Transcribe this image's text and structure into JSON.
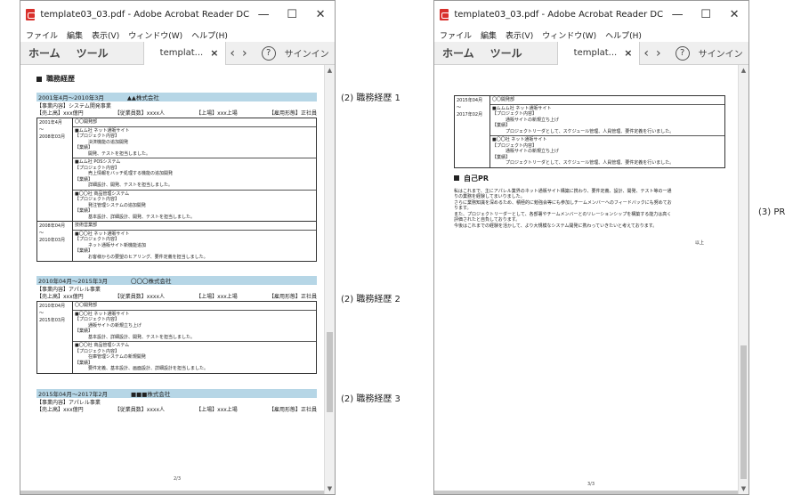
{
  "windows": [
    {
      "title": "template03_03.pdf - Adobe Acrobat Reader DC",
      "menu": [
        "ファイル",
        "編集",
        "表示(V)",
        "ウィンドウ(W)",
        "ヘルプ(H)"
      ],
      "toolbar": {
        "home": "ホーム",
        "tools": "ツール",
        "doc_tab": "templat...",
        "close": "×",
        "signin": "サインイン"
      }
    },
    {
      "title": "template03_03.pdf - Adobe Acrobat Reader DC",
      "menu": [
        "ファイル",
        "編集",
        "表示(V)",
        "ウィンドウ(W)",
        "ヘルプ(H)"
      ],
      "toolbar": {
        "home": "ホーム",
        "tools": "ツール",
        "doc_tab": "templat...",
        "close": "×",
        "signin": "サインイン"
      }
    }
  ],
  "page2": {
    "heading": "職務経歴",
    "careers": [
      {
        "period": "2001年4月～2010年3月",
        "company": "▲▲株式会社",
        "business": "【事業内容】システム開発事業",
        "capital": "【売上高】xxx億円",
        "employees": "【従業員数】xxxx人",
        "listing": "【上場】xxx上場",
        "employment": "【雇用形態】正社員",
        "rows": [
          {
            "from": "2001年4月",
            "tilde": "～",
            "to": "2008年03月",
            "blocks": [
              [
                "〇〇開発部"
              ],
              [
                "■ムム社 ネット通販サイト",
                "【プロジェクト内容】",
                "　決済機能の追加開発",
                "【業績】",
                "　開発、テストを担当しました。"
              ],
              [
                "■ムム社 POSシステム",
                "【プロジェクト内容】",
                "　売上情報をバッチ処理する機能の追加開発",
                "【業績】",
                "　詳細設計、開発、テストを担当しました。"
              ],
              [
                "■〇〇社 商品管理システム",
                "【プロジェクト内容】",
                "　発注管理システムの追加開発",
                "【業績】",
                "　基本設計、詳細設計、開発、テストを担当しました。"
              ]
            ]
          },
          {
            "from": "2008年04月",
            "tilde": "～",
            "to": "2010年03月",
            "blocks": [
              [
                "技術営業部"
              ],
              [
                "■〇〇社 ネット通販サイト",
                "【プロジェクト内容】",
                "　ネット通販サイト新機能追加",
                "【業績】",
                "　お客様からの要望のヒアリング、要件定義を担当しました。"
              ]
            ]
          }
        ]
      },
      {
        "period": "2010年04月～2015年3月",
        "company": "〇〇〇株式会社",
        "business": "【事業内容】アパレル事業",
        "capital": "【売上高】xxx億円",
        "employees": "【従業員数】xxxx人",
        "listing": "【上場】xxx上場",
        "employment": "【雇用形態】正社員",
        "rows": [
          {
            "from": "2010年04月",
            "tilde": "～",
            "to": "2015年03月",
            "blocks": [
              [
                "〇〇開発部"
              ],
              [
                "■〇〇社 ネット通販サイト",
                "【プロジェクト内容】",
                "　通販サイトの新規立ち上げ",
                "【業績】",
                "　基本設計、詳細設計、開発、テストを担当しました。"
              ],
              [
                "■〇〇社 商品管理システム",
                "【プロジェクト内容】",
                "　在庫管理システムの新規開発",
                "【業績】",
                "　要件定義、基本設計、画面設計、詳細設計を担当しました。"
              ]
            ]
          }
        ]
      },
      {
        "period": "2015年04月～2017年2月",
        "company": "■■■株式会社",
        "business": "【事業内容】アパレル事業",
        "capital": "【売上高】xxx億円",
        "employees": "【従業員数】xxxx人",
        "listing": "【上場】xxx上場",
        "employment": "【雇用形態】正社員",
        "rows": []
      }
    ],
    "page_number": "2/3"
  },
  "page3": {
    "row": {
      "from": "2015年04月",
      "tilde": "～",
      "to": "2017年02月",
      "blocks": [
        [
          "〇〇開発部"
        ],
        [
          "■ムムム社 ネット通販サイト",
          "【プロジェクト内容】",
          "　通販サイトの新規立ち上げ",
          "【業績】",
          "　プロジェクトリーダとして、スケジュール管理、人員管理、要件定義を行いました。"
        ],
        [
          "■〇〇社 ネット通販サイト",
          "【プロジェクト内容】",
          "　通販サイトの新規立ち上げ",
          "【業績】",
          "　プロジェクトリーダとして、スケジュール管理、人員管理、要件定義を行いました。"
        ]
      ]
    },
    "pr_heading": "自己PR",
    "pr_lines": [
      "私はこれまで、主にアパレル業界のネット通販サイト構築に携わり、要件定義、設計、開発、テスト等の一通",
      "りの業務を経験してまいりました。",
      "さらに業務知識を深めるため、積極的に勉強会等にも参加しチームメンバーへのフィードバックにも努めてお",
      "ります。",
      "また、プロジェクトリーダーとして、各部署やチームメンバーとのリレーションシップを構築する能力は高く",
      "評価されたと自負しております。",
      "今後はこれまでの経験を活かして、より大規模なシステム開発に携わっていきたいと考えております。"
    ],
    "closing": "以上",
    "page_number": "3/3"
  },
  "annotations": {
    "career1": "(2) 職務経歴 1",
    "career2": "(2) 職務経歴 2",
    "career3": "(2) 職務経歴 3",
    "pr": "(3) PR"
  }
}
